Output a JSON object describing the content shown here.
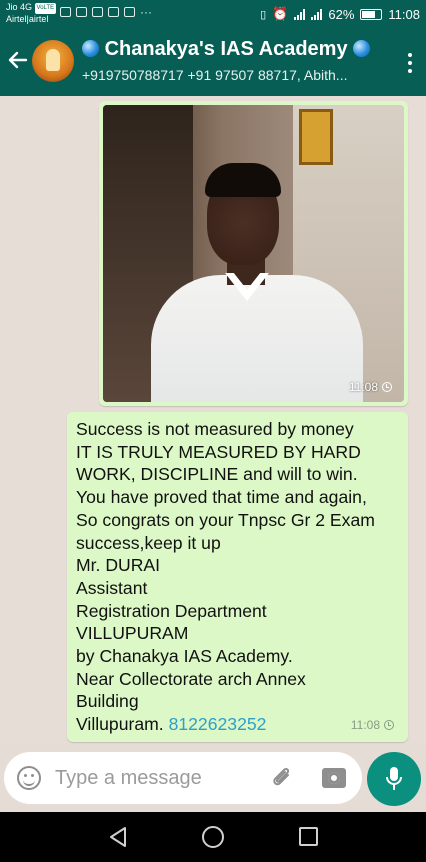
{
  "status_bar": {
    "carrier_line1": "Jio 4G",
    "carrier_badge": "VoLTE",
    "carrier_line2": "Airtel|airtel",
    "battery": "62%",
    "time": "11:08"
  },
  "header": {
    "back_icon": "arrow-left-icon",
    "title": "Chanakya's IAS Academy",
    "subtitle": "+919750788717 +91 97507 88717, Abith...",
    "menu_icon": "more-vertical-icon"
  },
  "messages": [
    {
      "type": "image",
      "time": "11:08",
      "status_icon": "clock-icon"
    },
    {
      "type": "text",
      "lines": [
        "Success is not measured by money",
        "IT IS TRULY MEASURED BY HARD",
        "WORK, DISCIPLINE and will to win.",
        "You have proved that time and again,",
        "So congrats on your Tnpsc Gr 2 Exam",
        "success,keep it up",
        "Mr. DURAI",
        "Assistant",
        "Registration  Department",
        "VILLUPURAM",
        "by Chanakya IAS Academy.",
        "Near Collectorate arch Annex",
        "Building",
        "Villupuram. "
      ],
      "phone_link": "8122623252",
      "time": "11:08",
      "status_icon": "clock-icon"
    }
  ],
  "input": {
    "placeholder": "Type a message",
    "value": ""
  },
  "colors": {
    "header": "#075e54",
    "outgoing_bubble": "#dcf8c6",
    "link": "#2f9fc8",
    "mic_button": "#0b8f7f"
  }
}
